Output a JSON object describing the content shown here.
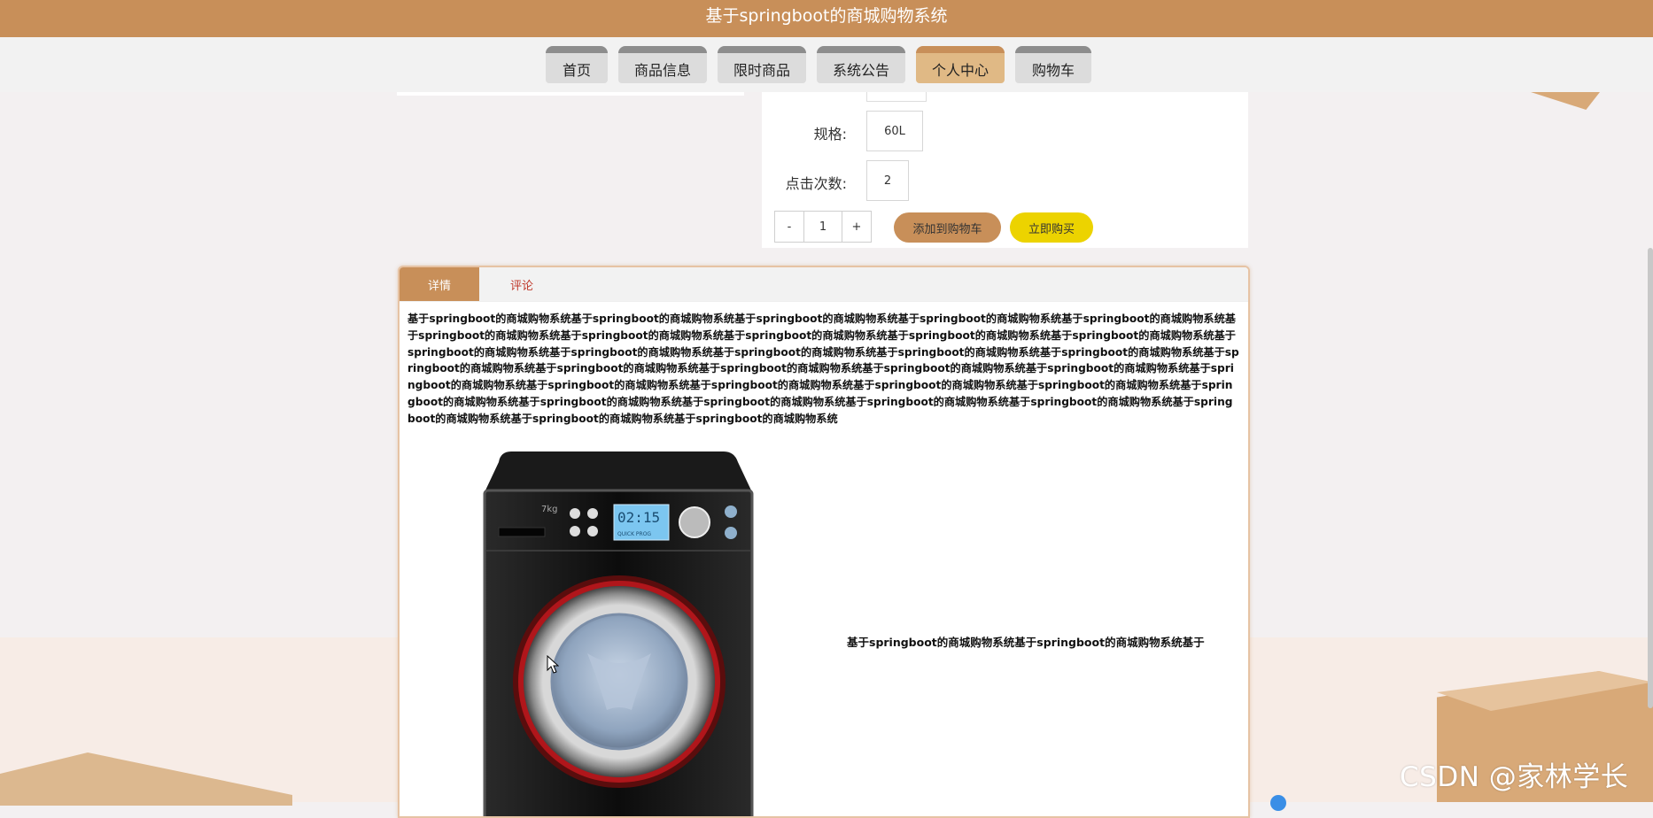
{
  "header": {
    "title": "基于springboot的商城购物系统"
  },
  "nav": {
    "items": [
      {
        "label": "首页"
      },
      {
        "label": "商品信息"
      },
      {
        "label": "限时商品"
      },
      {
        "label": "系统公告"
      },
      {
        "label": "个人中心"
      },
      {
        "label": "购物车"
      }
    ],
    "active": "个人中心"
  },
  "product": {
    "spec_label": "规格:",
    "spec_value": "60L",
    "clicks_label": "点击次数:",
    "clicks_value": "2",
    "qty_minus": "-",
    "qty_value": "1",
    "qty_plus": "+",
    "add_cart_label": "添加到购物车",
    "buy_now_label": "立即购买"
  },
  "detail": {
    "tabs": [
      {
        "label": "详情"
      },
      {
        "label": "评论"
      }
    ],
    "description": "基于springboot的商城购物系统基于springboot的商城购物系统基于springboot的商城购物系统基于springboot的商城购物系统基于springboot的商城购物系统基于springboot的商城购物系统基于springboot的商城购物系统基于springboot的商城购物系统基于springboot的商城购物系统基于springboot的商城购物系统基于springboot的商城购物系统基于springboot的商城购物系统基于springboot的商城购物系统基于springboot的商城购物系统基于springboot的商城购物系统基于springboot的商城购物系统基于springboot的商城购物系统基于springboot的商城购物系统基于springboot的商城购物系统基于springboot的商城购物系统基于springboot的商城购物系统基于springboot的商城购物系统基于springboot的商城购物系统基于springboot的商城购物系统基于springboot的商城购物系统基于springboot的商城购物系统基于springboot的商城购物系统基于springboot的商城购物系统基于springboot的商城购物系统基于springboot的商城购物系统基于springboot的商城购物系统基于springboot的商城购物系统基于springboot的商城购物系统",
    "side_text": "基于springboot的商城购物系统基于springboot的商城购物系统基于",
    "washer_display": {
      "time": "02:15",
      "sub": "QUICK PROG"
    }
  },
  "watermark": "CSDN @家林学长",
  "colors": {
    "brand": "#c88f59",
    "active_tab": "#e0b985",
    "buy": "#ecd300"
  }
}
